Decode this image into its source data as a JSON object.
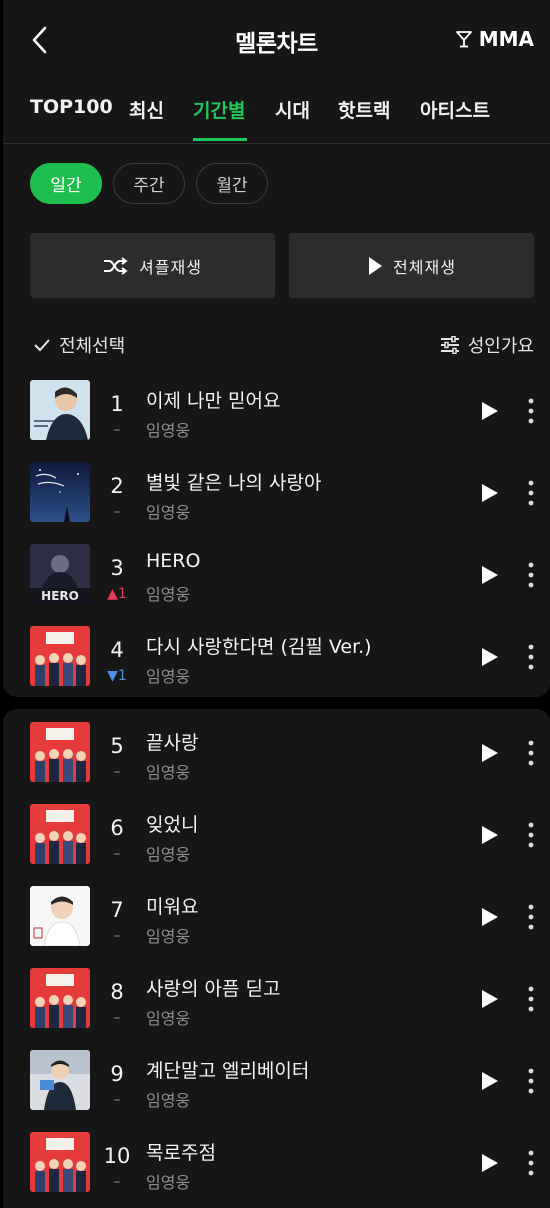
{
  "header": {
    "title": "멜론차트",
    "mma_label": "MMA"
  },
  "tabs": [
    "TOP100",
    "최신",
    "기간별",
    "시대",
    "핫트랙",
    "아티스트"
  ],
  "active_tab": "기간별",
  "period_options": [
    "일간",
    "주간",
    "월간"
  ],
  "active_period": "일간",
  "actions": {
    "shuffle_label": "셔플재생",
    "play_all_label": "전체재생"
  },
  "list_controls": {
    "select_all_label": "전체선택",
    "filter_label": "성인가요"
  },
  "colors": {
    "accent": "#1ec75b",
    "rank_up": "#e23a57",
    "rank_down": "#4d8fe6"
  },
  "songs": [
    {
      "rank": "1",
      "change": "–",
      "title": "이제 나만 믿어요",
      "artist": "임영웅"
    },
    {
      "rank": "2",
      "change": "–",
      "title": "별빛 같은 나의 사랑아",
      "artist": "임영웅"
    },
    {
      "rank": "3",
      "change": "▲1",
      "title": "HERO",
      "artist": "임영웅"
    },
    {
      "rank": "4",
      "change": "▼1",
      "title": "다시 사랑한다면 (김필 Ver.)",
      "artist": "임영웅"
    },
    {
      "rank": "5",
      "change": "–",
      "title": "끝사랑",
      "artist": "임영웅"
    },
    {
      "rank": "6",
      "change": "–",
      "title": "잊었니",
      "artist": "임영웅"
    },
    {
      "rank": "7",
      "change": "–",
      "title": "미워요",
      "artist": "임영웅"
    },
    {
      "rank": "8",
      "change": "–",
      "title": "사랑의 아픔 딛고",
      "artist": "임영웅"
    },
    {
      "rank": "9",
      "change": "–",
      "title": "계단말고 엘리베이터",
      "artist": "임영웅"
    },
    {
      "rank": "10",
      "change": "–",
      "title": "목로주점",
      "artist": "임영웅"
    }
  ],
  "album_art": {
    "cover1": "portrait-light-blue",
    "cover2": "night-sky-text",
    "cover3": "hero-dark",
    "cover4": "red-group-photo",
    "cover5": "red-group-photo",
    "cover6": "red-group-photo",
    "cover7": "portrait-white",
    "cover8": "red-group-photo",
    "cover9": "portrait-studio",
    "cover10": "red-group-photo"
  },
  "album_art_text": {
    "hero_cover": "HERO"
  }
}
